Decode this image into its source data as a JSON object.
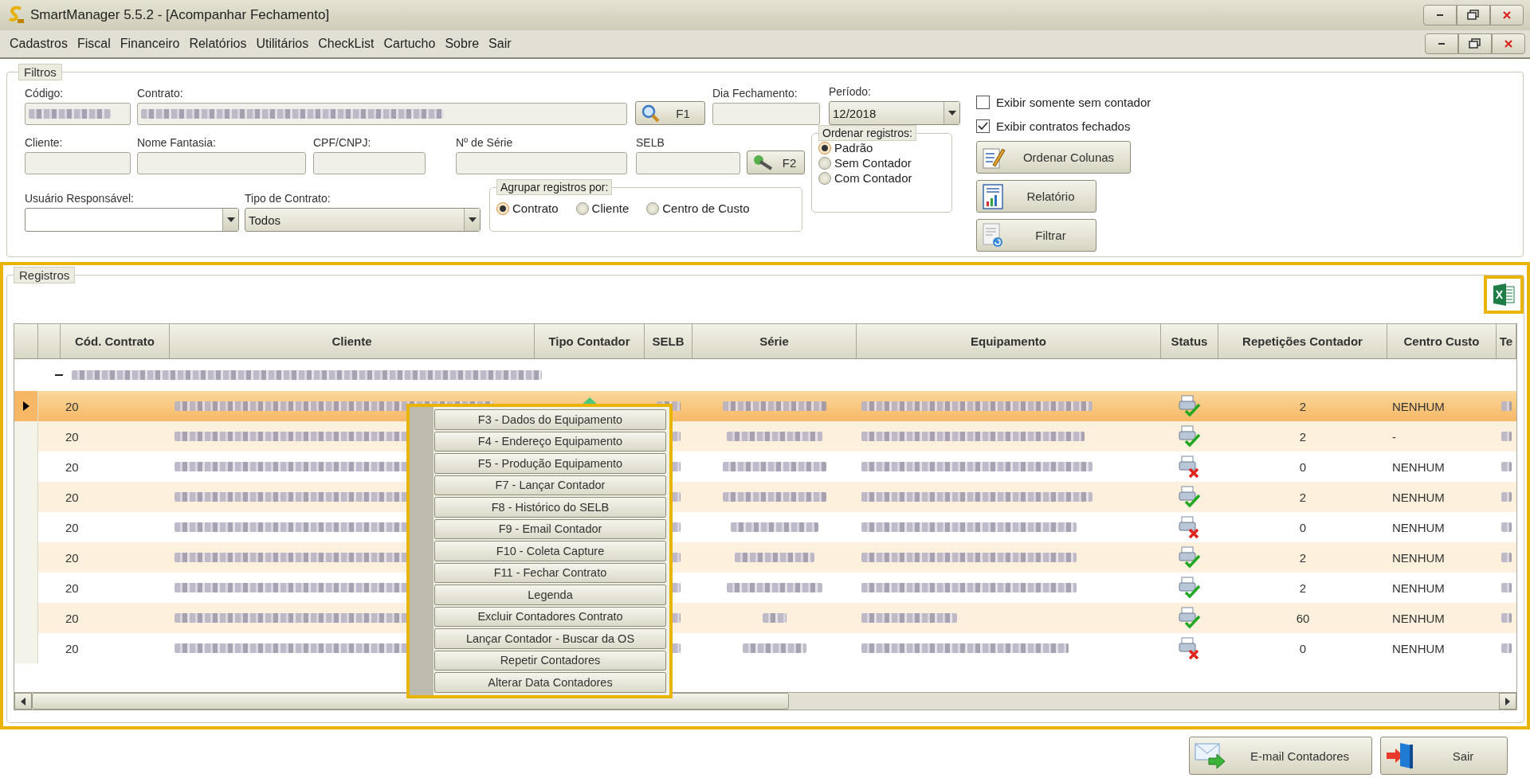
{
  "window": {
    "title": "SmartManager 5.5.2 - [Acompanhar Fechamento]"
  },
  "menu": [
    "Cadastros",
    "Fiscal",
    "Financeiro",
    "Relatórios",
    "Utilitários",
    "CheckList",
    "Cartucho",
    "Sobre",
    "Sair"
  ],
  "filters": {
    "title": "Filtros",
    "row1": [
      {
        "kind": "text",
        "label": "Código:",
        "redacted": true
      },
      {
        "kind": "text",
        "label": "Contrato:",
        "redacted": true
      },
      {
        "kind": "button",
        "label": "F1"
      },
      {
        "kind": "text",
        "label": "Dia Fechamento:",
        "redacted": false
      },
      {
        "kind": "combo",
        "label": "Período:",
        "value": "12/2018"
      }
    ],
    "row2": [
      {
        "kind": "text",
        "label": "Cliente:",
        "redacted": false
      },
      {
        "kind": "text",
        "label": "Nome Fantasia:",
        "redacted": false
      },
      {
        "kind": "text",
        "label": "CPF/CNPJ:",
        "redacted": false
      },
      {
        "kind": "text",
        "label": "Nº de Série",
        "redacted": false
      },
      {
        "kind": "text",
        "label": "SELB",
        "redacted": false
      },
      {
        "kind": "button",
        "label": "F2"
      }
    ],
    "row3": [
      {
        "kind": "combo",
        "label": "Usuário Responsável:"
      },
      {
        "kind": "combo",
        "label": "Tipo de Contrato:",
        "value": "Todos"
      }
    ],
    "group_by": {
      "title": "Agrupar registros por:",
      "options": [
        {
          "label": "Contrato",
          "selected": true
        },
        {
          "label": "Cliente",
          "selected": false
        },
        {
          "label": "Centro de Custo",
          "selected": false
        }
      ]
    },
    "order_by": {
      "title": "Ordenar registros:",
      "options": [
        {
          "label": "Padrão",
          "selected": true
        },
        {
          "label": "Sem Contador",
          "selected": false
        },
        {
          "label": "Com Contador",
          "selected": false
        }
      ]
    },
    "checkboxes": [
      {
        "label": "Exibir somente sem contador",
        "checked": false
      },
      {
        "label": "Exibir contratos fechados",
        "checked": true
      }
    ],
    "buttons": [
      "Ordenar Colunas",
      "Relatório",
      "Filtrar"
    ]
  },
  "records": {
    "title": "Registros",
    "highlighted": true,
    "export_highlighted": true,
    "columns": [
      "Cód. Contrato",
      "Cliente",
      "Tipo Contador",
      "SELB",
      "Série",
      "Equipamento",
      "Status",
      "Repetições Contador",
      "Centro Custo",
      "Te"
    ],
    "group": {
      "expanded": true
    },
    "rows": [
      {
        "cod": "20",
        "selected": true,
        "status_ok": true,
        "repeticoes": "2",
        "centro_custo": "NENHUM"
      },
      {
        "cod": "20",
        "selected": false,
        "status_ok": true,
        "repeticoes": "2",
        "centro_custo": "-"
      },
      {
        "cod": "20",
        "selected": false,
        "status_ok": false,
        "repeticoes": "0",
        "centro_custo": "NENHUM"
      },
      {
        "cod": "20",
        "selected": false,
        "status_ok": true,
        "repeticoes": "2",
        "centro_custo": "NENHUM"
      },
      {
        "cod": "20",
        "selected": false,
        "status_ok": false,
        "repeticoes": "0",
        "centro_custo": "NENHUM"
      },
      {
        "cod": "20",
        "selected": false,
        "status_ok": true,
        "repeticoes": "2",
        "centro_custo": "NENHUM"
      },
      {
        "cod": "20",
        "selected": false,
        "status_ok": true,
        "repeticoes": "2",
        "centro_custo": "NENHUM"
      },
      {
        "cod": "20",
        "selected": false,
        "status_ok": true,
        "repeticoes": "60",
        "centro_custo": "NENHUM"
      },
      {
        "cod": "20",
        "selected": false,
        "status_ok": false,
        "repeticoes": "0",
        "centro_custo": "NENHUM"
      }
    ],
    "context_menu": {
      "highlighted": true,
      "items": [
        "F3 - Dados do Equipamento",
        "F4 - Endereço Equipamento",
        "F5 - Produção Equipamento",
        "F7 - Lançar Contador",
        "F8 - Histórico do SELB",
        "F9 - Email Contador",
        "F10 - Coleta Capture",
        "F11 - Fechar Contrato",
        "Legenda",
        "Excluir Contadores Contrato",
        "Lançar Contador - Buscar da OS",
        "Repetir Contadores",
        "Alterar Data Contadores"
      ]
    }
  },
  "footer_buttons": [
    "E-mail Contadores",
    "Sair"
  ]
}
